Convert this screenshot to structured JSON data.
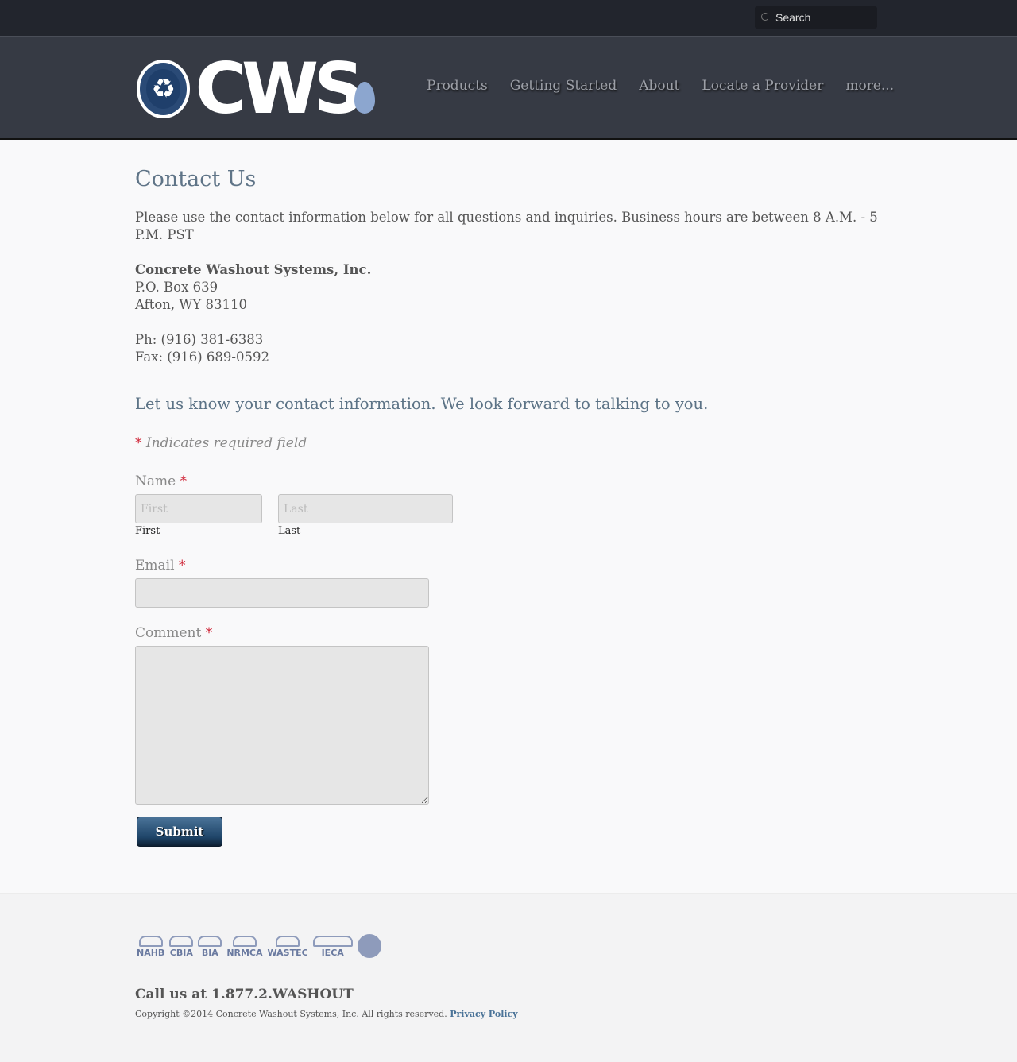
{
  "search": {
    "placeholder": "Search"
  },
  "logo": {
    "badge_text": "Concrete Washout Systems, Inc.",
    "wordmark": "CWS"
  },
  "nav": {
    "items": [
      {
        "label": "Products"
      },
      {
        "label": "Getting Started"
      },
      {
        "label": "About"
      },
      {
        "label": "Locate a Provider"
      },
      {
        "label": "more..."
      }
    ]
  },
  "page": {
    "title": "Contact Us",
    "intro": "Please use the contact information below for all questions and inquiries. Business hours are between 8 A.M. - 5 P.M. PST",
    "company_name": "Concrete Washout Systems, Inc.",
    "address_line1": "P.O. Box 639",
    "address_line2": "Afton, WY 83110",
    "phone": "Ph: (916) 381-6383",
    "fax": "Fax: (916) 689-0592"
  },
  "form": {
    "heading": "Let us know your contact information. We look forward to talking to you.",
    "required_marker": "*",
    "required_note": "Indicates required field",
    "name_label": "Name",
    "first": {
      "placeholder": "First",
      "sublabel": "First",
      "value": ""
    },
    "last": {
      "placeholder": "Last",
      "sublabel": "Last",
      "value": ""
    },
    "email_label": "Email",
    "email_value": "",
    "comment_label": "Comment",
    "comment_value": "",
    "submit_label": "Submit"
  },
  "footer": {
    "partners": [
      "NAHB",
      "CBIA",
      "BIA",
      "NRMCA",
      "WASTEC",
      "IECA",
      ""
    ],
    "call_us": "Call us at 1.877.2.WASHOUT",
    "copyright": "Copyright ©2014 Concrete Washout Systems, Inc. All rights reserved.",
    "privacy_label": "Privacy Policy"
  },
  "colors": {
    "header_bg": "#363a44",
    "topbar_bg": "#22252d",
    "title_blue": "#5f7487",
    "required_red": "#d0283a",
    "button_blue": "#1f4569",
    "link_blue": "#4a7398"
  }
}
